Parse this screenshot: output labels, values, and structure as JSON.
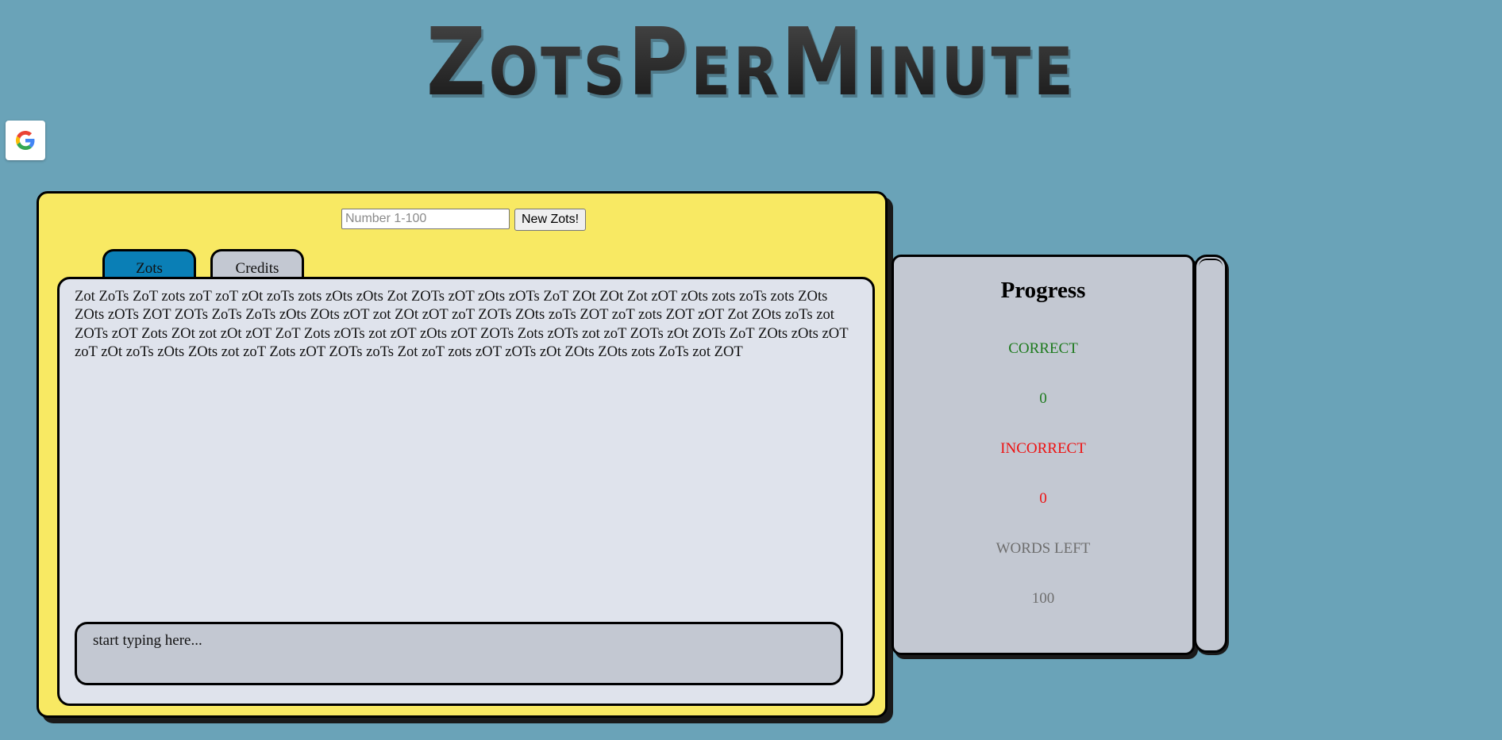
{
  "logo": {
    "text": "ZotsPerMinute"
  },
  "google": {
    "icon": "google-icon"
  },
  "controls": {
    "number_placeholder": "Number 1-100",
    "new_button_label": "New Zots!"
  },
  "tabs": [
    {
      "label": "Zots",
      "active": true
    },
    {
      "label": "Credits",
      "active": false
    }
  ],
  "zots": {
    "text": "Zot ZoTs ZoT zots zoT zoT zOt zoTs zots zOts zOts Zot ZOTs zOT zOts zOTs ZoT ZOt ZOt Zot zOT zOts zots zoTs zots ZOts ZOts zOTs ZOT ZOTs ZoTs ZoTs zOts ZOts zOT zot ZOt zOT zoT ZOTs ZOts zoTs ZOT zoT zots ZOT zOT Zot ZOts zoTs zot ZOTs zOT Zots ZOt zot zOt zOT ZoT Zots zOTs zot zOT zOts zOT ZOTs Zots zOTs zot zoT ZOTs zOt ZOTs ZoT ZOts zOts zOT zoT zOt zoTs zOts ZOts zot zoT Zots zOT ZOTs zoTs Zot zoT zots zOT zOTs zOt ZOts ZOts zots ZoTs zot ZOT",
    "typing_placeholder": "start typing here..."
  },
  "progress": {
    "title": "Progress",
    "correct_label": "CORRECT",
    "correct_value": "0",
    "incorrect_label": "INCORRECT",
    "incorrect_value": "0",
    "words_left_label": "WORDS LEFT",
    "words_left_value": "100"
  },
  "colors": {
    "background": "#6aa3b8",
    "panel": "#f8e963",
    "active_tab": "#0a7fb6",
    "inactive": "#c3c8d2",
    "correct": "#1d7a1d",
    "incorrect": "#ee1111",
    "muted": "#6e6e6e"
  }
}
